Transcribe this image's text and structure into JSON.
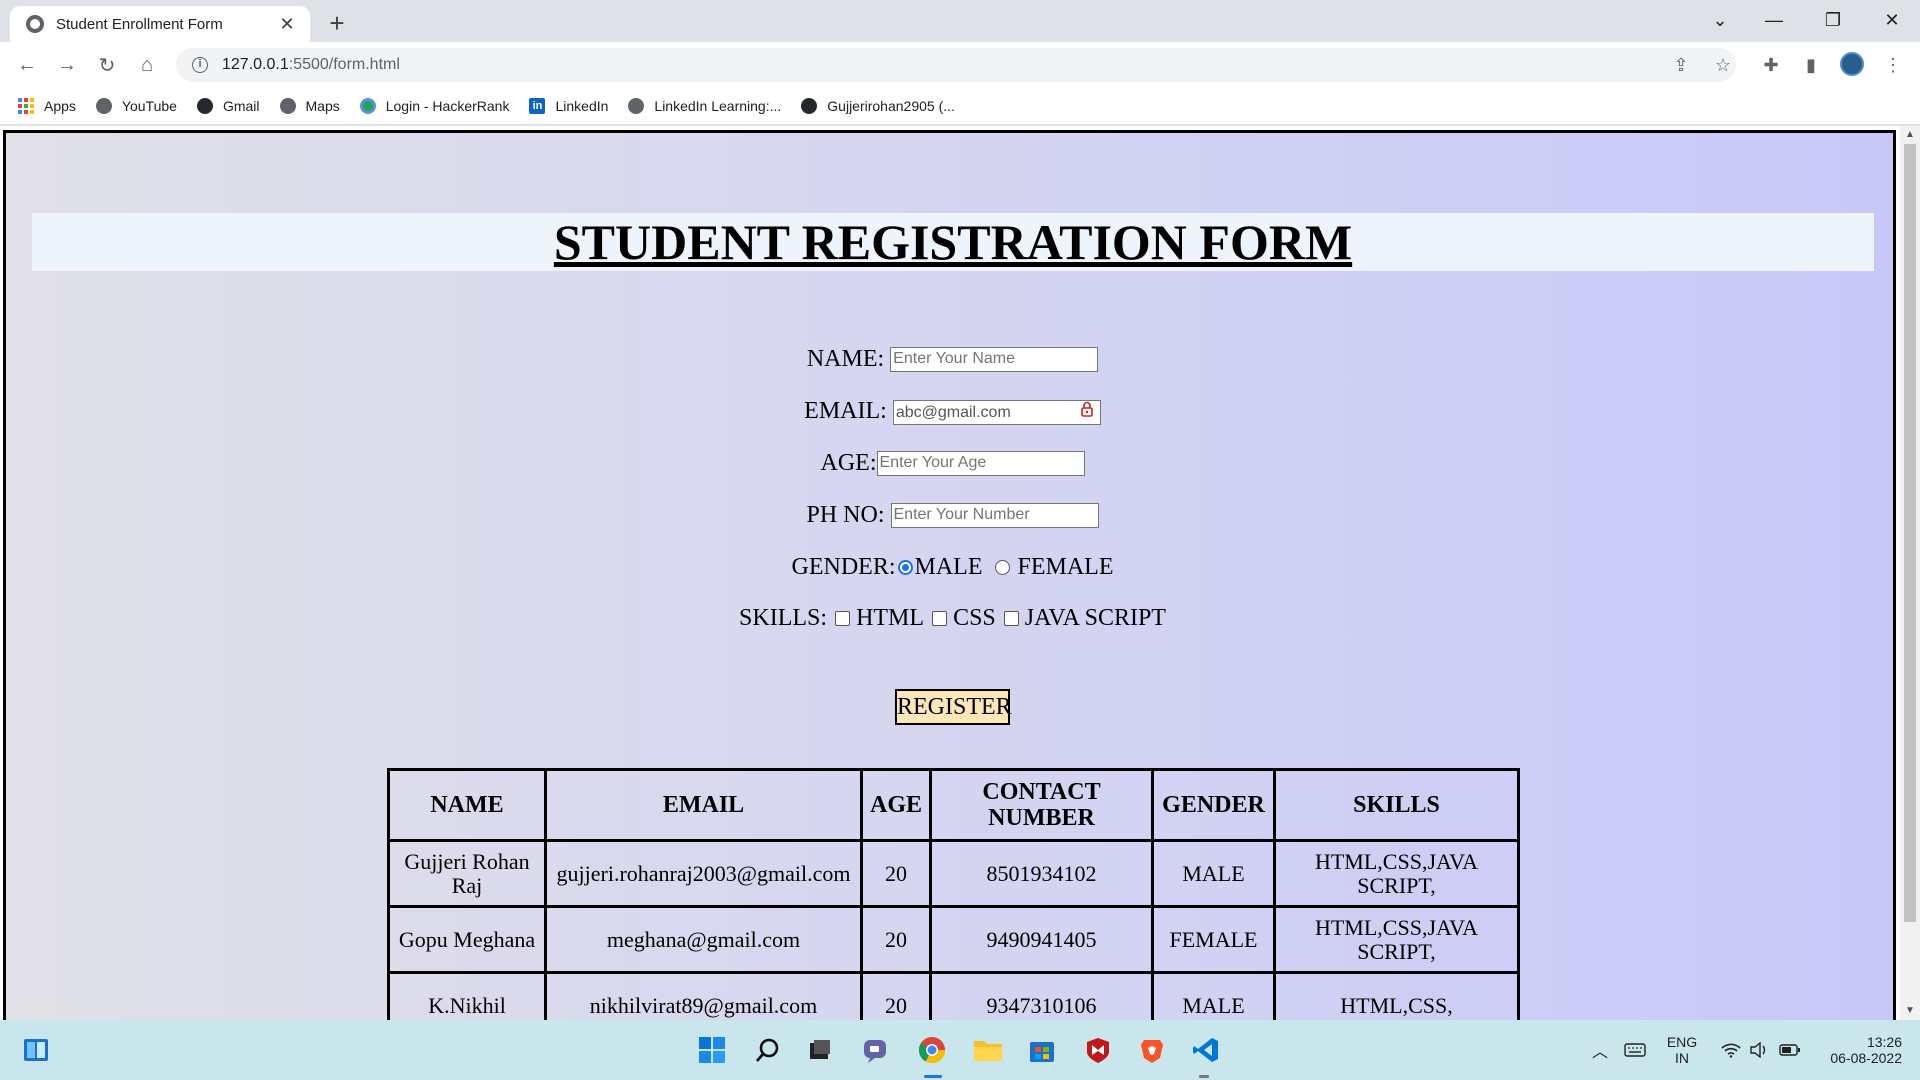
{
  "browser": {
    "tab_title": "Student Enrollment Form",
    "url_host": "127.0.0.1",
    "url_rest": ":5500/form.html",
    "bookmarks": [
      "Apps",
      "YouTube",
      "Gmail",
      "Maps",
      "Login - HackerRank",
      "LinkedIn",
      "LinkedIn Learning:...",
      "Gujjerirohan2905 (..."
    ]
  },
  "page": {
    "heading": "STUDENT REGISTRATION FORM",
    "form": {
      "name_label": "NAME:",
      "name_placeholder": "Enter Your Name",
      "email_label": "EMAIL:",
      "email_value": "abc@gmail.com",
      "age_label": "AGE:",
      "age_placeholder": "Enter Your Age",
      "phone_label": "PH NO:",
      "phone_placeholder": "Enter Your Number",
      "gender_label": "GENDER:",
      "gender_options": [
        "MALE",
        "FEMALE"
      ],
      "gender_selected": "MALE",
      "skills_label": "SKILLS:",
      "skills_options": [
        "HTML",
        "CSS",
        "JAVA SCRIPT"
      ],
      "register_label": "REGISTER"
    },
    "table": {
      "headers": [
        "NAME",
        "EMAIL",
        "AGE",
        "CONTACT NUMBER",
        "GENDER",
        "SKILLS"
      ],
      "rows": [
        [
          "Gujjeri Rohan Raj",
          "gujjeri.rohanraj2003@gmail.com",
          "20",
          "8501934102",
          "MALE",
          "HTML,CSS,JAVA SCRIPT,"
        ],
        [
          "Gopu Meghana",
          "meghana@gmail.com",
          "20",
          "9490941405",
          "FEMALE",
          "HTML,CSS,JAVA SCRIPT,"
        ],
        [
          "K.Nikhil",
          "nikhilvirat89@gmail.com",
          "20",
          "9347310106",
          "MALE",
          "HTML,CSS,"
        ]
      ]
    }
  },
  "taskbar": {
    "language": "ENG",
    "region": "IN",
    "time": "13:26",
    "date": "06-08-2022"
  },
  "colors": {
    "register_bg": "#fde7b9",
    "banner_bg": "#eef4fb",
    "taskbar_bg": "#c8e6ec"
  }
}
